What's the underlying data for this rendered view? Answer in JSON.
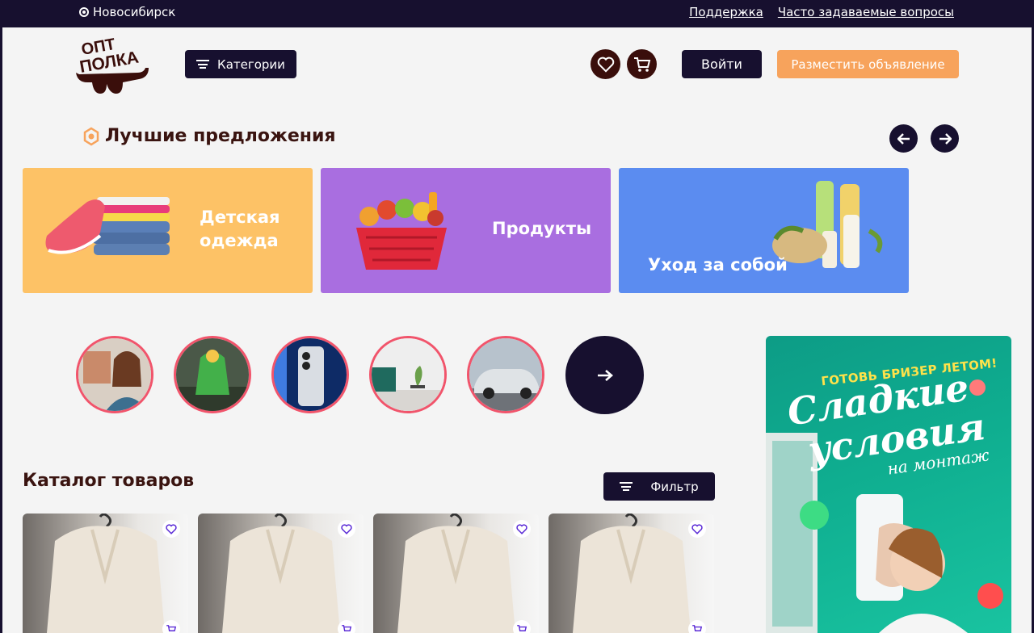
{
  "topbar": {
    "city": "Новосибирск",
    "links": [
      "Поддержка",
      "Часто задаваемые вопросы"
    ]
  },
  "header": {
    "logo_text": [
      "ОПТ",
      "ПОЛКА"
    ],
    "categories_label": "Категории",
    "login_label": "Войти",
    "post_ad_label": "Разместить объявление"
  },
  "best_offers": {
    "title": "Лучшие предложения",
    "banners": [
      {
        "label_line1": "Детская",
        "label_line2": "одежда",
        "color": "#fdc266"
      },
      {
        "label": "Продукты",
        "color": "#a96ee0"
      },
      {
        "label": "Уход за собой",
        "color": "#5b8cf0"
      }
    ]
  },
  "stories": {
    "items": [
      "story-person",
      "story-kids-clothes",
      "story-phone",
      "story-furniture",
      "story-car"
    ]
  },
  "ad": {
    "tag": "ГОТОВЬ БРИЗЕР ЛЕТОМ!",
    "headline1": "Сладкие",
    "headline2": "условия",
    "sub": "на монтаж"
  },
  "catalog": {
    "title": "Каталог товаров",
    "filter_label": "Фильтр",
    "cards": [
      {
        "item": "coat"
      },
      {
        "item": "coat"
      },
      {
        "item": "coat"
      },
      {
        "item": "coat"
      }
    ]
  },
  "colors": {
    "dark": "#17102f",
    "accent": "#f7a35c",
    "brand_brown": "#3a0e0b"
  }
}
